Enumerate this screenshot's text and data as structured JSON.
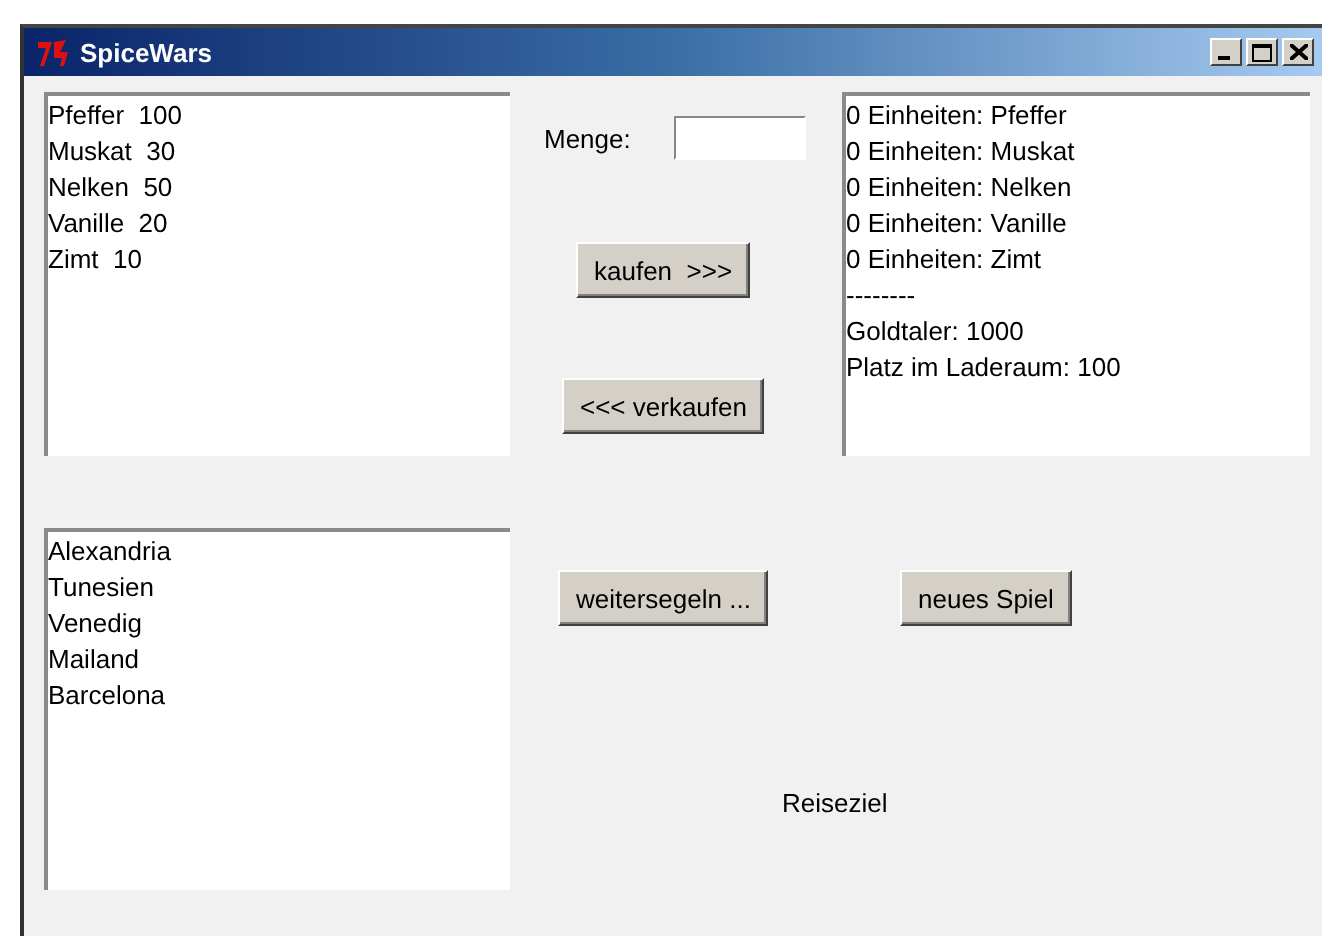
{
  "window": {
    "title": "SpiceWars"
  },
  "market": {
    "items": [
      {
        "text": "Pfeffer  100",
        "selected": false
      },
      {
        "text": "Muskat  30",
        "selected": false
      },
      {
        "text": "Nelken  50",
        "selected": false
      },
      {
        "text": "Vanille  20",
        "selected": false
      },
      {
        "text": "Zimt  10",
        "selected": false
      }
    ]
  },
  "quantity": {
    "label": "Menge:"
  },
  "buttons": {
    "buy": "kaufen  >>>",
    "sell": "<<< verkaufen",
    "sail": "weitersegeln ...",
    "new_game": "neues Spiel"
  },
  "cargo": {
    "items": [
      {
        "text": "0 Einheiten: Pfeffer",
        "selected": false
      },
      {
        "text": "0 Einheiten: Muskat",
        "selected": false
      },
      {
        "text": "0 Einheiten: Nelken",
        "selected": false
      },
      {
        "text": "0 Einheiten: Vanille",
        "selected": false
      },
      {
        "text": "0 Einheiten: Zimt",
        "selected": false
      },
      {
        "text": "--------",
        "selected": false
      },
      {
        "text": "Goldtaler: 1000",
        "selected": false
      },
      {
        "text": "Platz im Laderaum: 100",
        "selected": false
      }
    ]
  },
  "destinations": {
    "items": [
      {
        "text": "Alexandria",
        "selected": false
      },
      {
        "text": "Tunesien",
        "selected": false
      },
      {
        "text": "Venedig",
        "selected": false
      },
      {
        "text": "Mailand",
        "selected": false
      },
      {
        "text": "Barcelona",
        "selected": false
      }
    ]
  },
  "destination_label": "Reiseziel"
}
